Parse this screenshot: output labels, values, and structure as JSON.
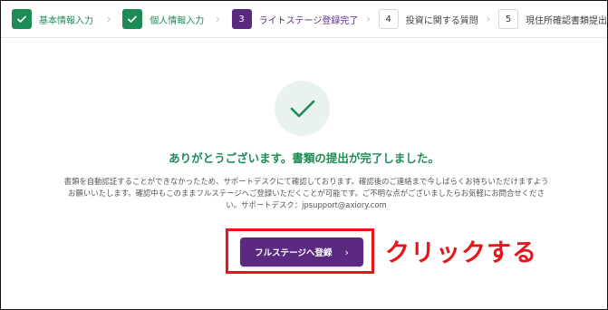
{
  "steps": [
    {
      "number": "1",
      "label": "基本情報入力",
      "status": "done"
    },
    {
      "number": "2",
      "label": "個人情報入力",
      "status": "done"
    },
    {
      "number": "3",
      "label": "ライトステージ登録完了",
      "status": "current"
    },
    {
      "number": "4",
      "label": "投資に関する質問",
      "status": "todo"
    },
    {
      "number": "5",
      "label": "現住所確認書類提出",
      "status": "todo"
    }
  ],
  "icons": {
    "step_done": "check-icon",
    "step_separator": "chevron-right-icon",
    "success": "check-icon",
    "button_arrow": "chevron-right-icon"
  },
  "colors": {
    "success_green": "#1e8b57",
    "brand_purple": "#5b2a80",
    "annotation_red": "#e8141a",
    "success_circle_bg": "#e9f2ef"
  },
  "main": {
    "title": "ありがとうございます。書類の提出が完了しました。",
    "description_line1": "書類を自動認証することができなかったため、サポートデスクにて確認しております。確認後のご連絡まで今しばらくお待ちいただけますよう",
    "description_line2": "お願いいたします。確認中もこのままフルステージへご登録いただくことが可能です。ご不明な点がございましたらお気軽にお問合せくださ",
    "description_line3": "い。サポートデスク：jpsupport@axiory.com",
    "cta_label": "フルステージへ登録",
    "cta_arrow": "›"
  },
  "annotation": {
    "text": "クリックする"
  }
}
